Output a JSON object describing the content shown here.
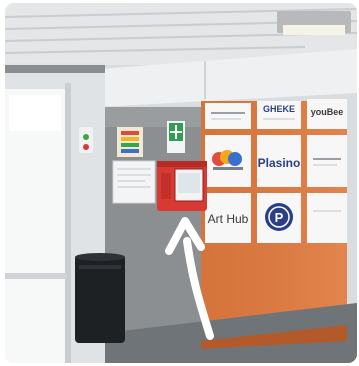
{
  "photo": {
    "subject": "corridor-wall-with-defibrillator-cabinet",
    "arrow_color": "#ffffff",
    "orange_wall_color": "#e07a3e",
    "grey_wall_color": "#8c8f92",
    "directory_signs": [
      {
        "label": "",
        "style": "plain"
      },
      {
        "label": "GHEKE",
        "style": "bold-blue"
      },
      {
        "label": "youBee",
        "style": "dark"
      },
      {
        "label": "",
        "style": "colorful-logo"
      },
      {
        "label": "Plasino",
        "style": "bold-blue"
      },
      {
        "label": "",
        "style": "plain"
      },
      {
        "label": "Art Hub",
        "style": "dark"
      },
      {
        "label": "P",
        "style": "circle-logo"
      },
      {
        "label": "",
        "style": "plain"
      }
    ]
  }
}
